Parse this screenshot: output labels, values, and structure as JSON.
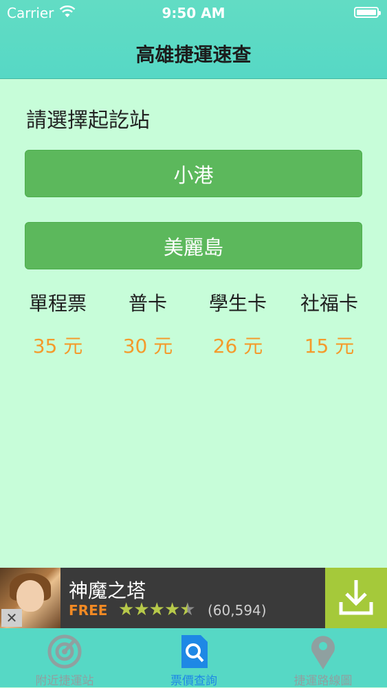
{
  "status_bar": {
    "carrier": "Carrier",
    "time": "9:50 AM"
  },
  "nav": {
    "title": "高雄捷運速查"
  },
  "selector": {
    "prompt": "請選擇起訖站",
    "start_station": "小港",
    "end_station": "美麗島"
  },
  "fares": [
    {
      "name": "單程票",
      "price": "35 元"
    },
    {
      "name": "普卡",
      "price": "30 元"
    },
    {
      "name": "學生卡",
      "price": "26 元"
    },
    {
      "name": "社福卡",
      "price": "15 元"
    }
  ],
  "ad": {
    "title": "神魔之塔",
    "free_label": "FREE",
    "rating": 4.5,
    "rating_count": "(60,594)",
    "close_label": "✕"
  },
  "tabs": [
    {
      "label": "附近捷運站",
      "icon": "radar-icon"
    },
    {
      "label": "票價查詢",
      "icon": "fare-search-icon"
    },
    {
      "label": "捷運路線圖",
      "icon": "map-pin-icon"
    }
  ],
  "colors": {
    "accent": "#56d8c5",
    "background": "#c7fdd9",
    "button": "#5cb85c",
    "price": "#f49a2b",
    "tab_active": "#1e88e5"
  }
}
